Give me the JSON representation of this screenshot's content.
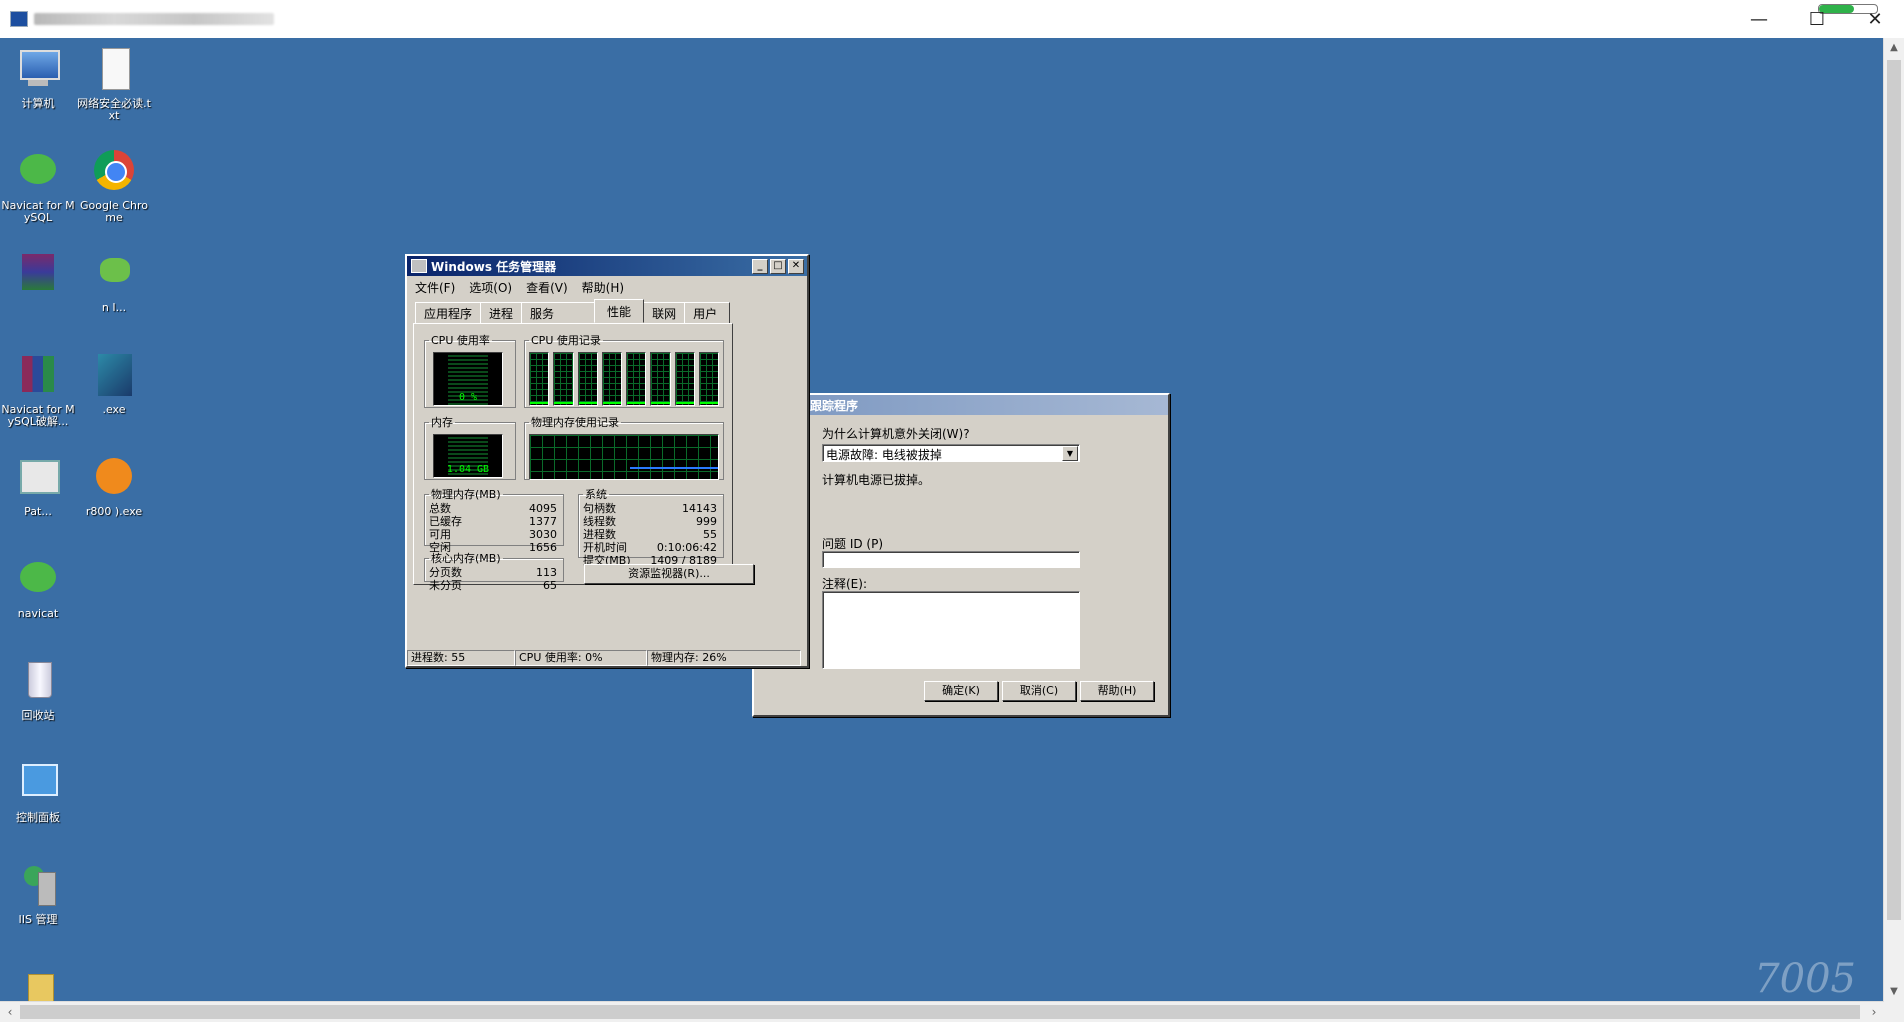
{
  "rdp_window": {
    "title": "",
    "minimize_glyph": "—",
    "maximize_glyph": "☐",
    "close_glyph": "✕"
  },
  "desktop_icons": [
    {
      "name": "computer-icon",
      "label": "计算机"
    },
    {
      "name": "text-file-icon",
      "label": "网络安全必读.txt"
    },
    {
      "name": "navicat-icon",
      "label": "Navicat for MySQL"
    },
    {
      "name": "chrome-icon",
      "label": "Google Chrome"
    },
    {
      "name": "archive-icon",
      "label": ""
    },
    {
      "name": "frog-icon",
      "label": "n I..."
    },
    {
      "name": "winrar-icon",
      "label": "Navicat for MySQL破解..."
    },
    {
      "name": "exe-icon",
      "label": ".exe"
    },
    {
      "name": "patch-icon",
      "label": "Pat..."
    },
    {
      "name": "orange-tool-icon",
      "label": "r800 ).exe"
    },
    {
      "name": "navicat-2-icon",
      "label": "navicat"
    },
    {
      "name": "recycle-bin-icon",
      "label": "回收站"
    },
    {
      "name": "control-panel-icon",
      "label": "控制面板"
    },
    {
      "name": "iis-manager-icon",
      "label": "IIS 管理"
    },
    {
      "name": "folder-icon",
      "label": ""
    }
  ],
  "task_manager": {
    "title": "Windows 任务管理器",
    "menu": [
      "文件(F)",
      "选项(O)",
      "查看(V)",
      "帮助(H)"
    ],
    "tabs": [
      "应用程序",
      "进程",
      "服务",
      "性能",
      "联网",
      "用户"
    ],
    "active_tab": "性能",
    "cpu_usage": {
      "legend": "CPU 使用率",
      "value": "0 %"
    },
    "cpu_history": {
      "legend": "CPU 使用记录",
      "cores": 8
    },
    "memory": {
      "legend": "内存",
      "value": "1.04 GB"
    },
    "memory_history": {
      "legend": "物理内存使用记录"
    },
    "physical_memory": {
      "legend": "物理内存(MB)",
      "rows": [
        {
          "label": "总数",
          "value": "4095"
        },
        {
          "label": "已缓存",
          "value": "1377"
        },
        {
          "label": "可用",
          "value": "3030"
        },
        {
          "label": "空闲",
          "value": "1656"
        }
      ]
    },
    "kernel_memory": {
      "legend": "核心内存(MB)",
      "rows": [
        {
          "label": "分页数",
          "value": "113"
        },
        {
          "label": "未分页",
          "value": "65"
        }
      ]
    },
    "system": {
      "legend": "系统",
      "rows": [
        {
          "label": "句柄数",
          "value": "14143"
        },
        {
          "label": "线程数",
          "value": "999"
        },
        {
          "label": "进程数",
          "value": "55"
        },
        {
          "label": "开机时间",
          "value": "0:10:06:42"
        },
        {
          "label": "提交(MB)",
          "value": "1409 / 8189"
        }
      ]
    },
    "resource_monitor_button": "资源监视器(R)...",
    "status": {
      "processes": "进程数: 55",
      "cpu": "CPU 使用率: 0%",
      "memory": "物理内存: 26%"
    }
  },
  "shutdown_tracker": {
    "title": "跟踪程序",
    "question": "为什么计算机意外关闭(W)?",
    "reason_selected": "电源故障: 电线被拔掉",
    "description": "计算机电源已拔掉。",
    "problem_id_label": "问题 ID (P)",
    "problem_id_value": "",
    "comment_label": "注释(E):",
    "comment_value": "",
    "ok_button": "确定(K)",
    "cancel_button": "取消(C)",
    "help_button": "帮助(H)"
  },
  "watermark": "7005"
}
